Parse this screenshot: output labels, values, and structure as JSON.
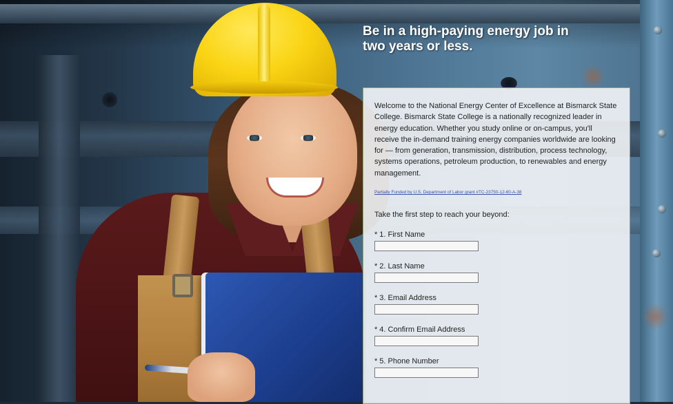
{
  "headline": "Be in a high-paying energy job in\ntwo years or less.",
  "intro_text": "Welcome to the National Energy Center of Excellence at Bismarck State College. Bismarck State College is a nationally recognized leader in energy education. Whether you study online or on-campus, you'll receive the in-demand training energy companies worldwide are looking for — from generation, transmission, distribution, process technology, systems operations, petroleum production, to renewables and energy management.",
  "grant_link": "Partially Funded by U.S. Department of Labor grant #TC-23750-12-60-A-38",
  "form_intro": "Take the first step to reach your beyond:",
  "fields": [
    {
      "required": "*",
      "label": "1. First Name",
      "value": ""
    },
    {
      "required": "*",
      "label": "2. Last Name",
      "value": ""
    },
    {
      "required": "*",
      "label": "3. Email Address",
      "value": ""
    },
    {
      "required": "*",
      "label": "4. Confirm Email Address",
      "value": ""
    },
    {
      "required": "*",
      "label": "5. Phone Number",
      "value": ""
    }
  ],
  "colors": {
    "hardhat": "#fad414",
    "shirt": "#4b1416",
    "binder": "#1d3f8f",
    "panel_border": "#8fa173",
    "link": "#3a53a8"
  },
  "icons": {
    "photo": "woman-in-hardhat-photo"
  }
}
